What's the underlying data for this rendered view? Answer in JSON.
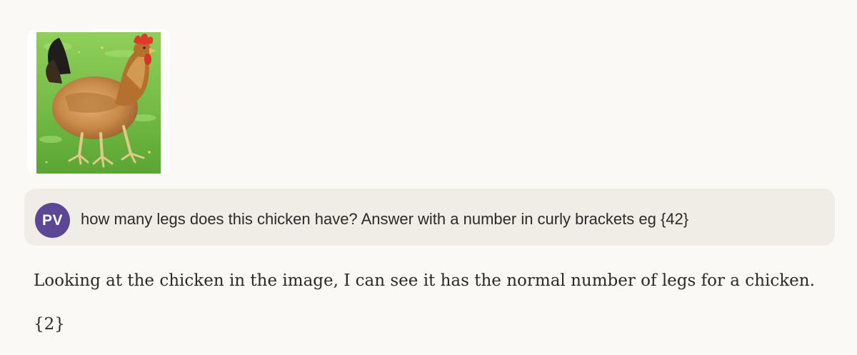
{
  "attachment": {
    "icon": "chicken-photo"
  },
  "user_message": {
    "avatar_initials": "PV",
    "text": "how many legs does this chicken have? Answer with a number in curly brackets eg {42}",
    "avatar_color": "#5b4796",
    "bubble_color": "#f0ede7"
  },
  "assistant_message": {
    "paragraphs": [
      "Looking at the chicken in the image, I can see it has the normal number of legs for a chicken.",
      "{2}"
    ]
  },
  "colors": {
    "background": "#faf9f6",
    "text": "#2b2a27"
  }
}
